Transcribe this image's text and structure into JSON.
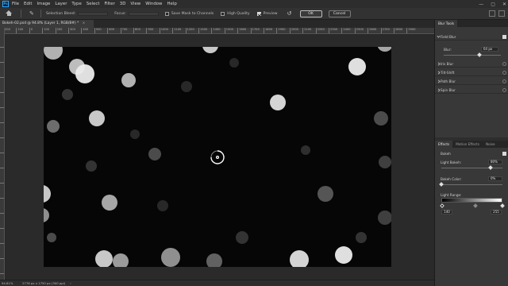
{
  "menu": {
    "logo": "Ps",
    "items": [
      "File",
      "Edit",
      "Image",
      "Layer",
      "Type",
      "Select",
      "Filter",
      "3D",
      "View",
      "Window",
      "Help"
    ],
    "window_controls": [
      "—",
      "▢",
      "✕"
    ]
  },
  "options": {
    "selection_bleed_label": "Selection Bleed:",
    "focus_label": "Focus:",
    "save_mask_label": "Save Mask to Channels",
    "save_mask_checked": false,
    "high_quality_label": "High Quality",
    "high_quality_checked": false,
    "preview_label": "Preview",
    "preview_checked": true,
    "ok_label": "OK",
    "cancel_label": "Cancel"
  },
  "document": {
    "tab_title": "Bokeh-02.psd @ 94.8% (Layer 1, RGB/8#) *",
    "close": "×"
  },
  "ruler": {
    "top_ticks": [
      "200",
      "100",
      "0",
      "100",
      "200",
      "300",
      "400",
      "500",
      "600",
      "700",
      "800",
      "900",
      "1000",
      "1100",
      "1200",
      "1300",
      "1400",
      "1500",
      "1600",
      "1700",
      "1800",
      "1900",
      "2000",
      "2100",
      "2200",
      "2300",
      "2400",
      "2500",
      "2600",
      "2700",
      "2800",
      "2900"
    ],
    "left_ticks": [
      "0",
      "1",
      "2",
      "3",
      "4",
      "5",
      "6",
      "7",
      "8",
      "9",
      "10",
      "11",
      "12",
      "13",
      "14",
      "15"
    ]
  },
  "status": {
    "zoom": "94.81%",
    "doc_info": "2776 px x 1750 px (300 ppi)",
    "arrow": "›"
  },
  "blur_tools": {
    "tab_label": "Blur Tools",
    "rows": [
      {
        "label": "Field Blur",
        "expanded": true,
        "enabled": true
      },
      {
        "label": "Iris Blur",
        "expanded": false,
        "enabled": false
      },
      {
        "label": "Tilt-Shift",
        "expanded": false,
        "enabled": false
      },
      {
        "label": "Path Blur",
        "expanded": false,
        "enabled": false
      },
      {
        "label": "Spin Blur",
        "expanded": false,
        "enabled": false
      }
    ],
    "blur_label": "Blur:",
    "blur_value": "64 px",
    "blur_fraction": 0.62
  },
  "effects": {
    "tabs": [
      "Effects",
      "Motion Effects",
      "Noise"
    ],
    "active_tab": "Effects",
    "bokeh_label": "Bokeh",
    "bokeh_checked": true,
    "light_bokeh_label": "Light Bokeh:",
    "light_bokeh_value": "80%",
    "light_bokeh_fraction": 0.8,
    "bokeh_color_label": "Bokeh Color:",
    "bokeh_color_value": "0%",
    "bokeh_color_fraction": 0.0,
    "light_range_label": "Light Range:",
    "light_range_low": "140",
    "light_range_high": "255"
  }
}
